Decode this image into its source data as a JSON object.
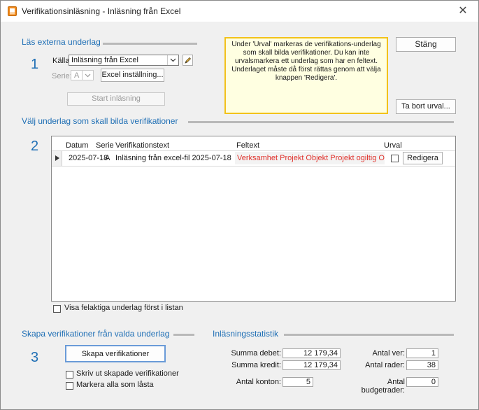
{
  "window": {
    "title": "Verifikationsinläsning - Inläsning från Excel"
  },
  "section1": {
    "heading": "Läs externa underlag",
    "number": "1",
    "source_label": "Källa:",
    "source_value": "Inläsning från Excel",
    "serie_label": "Serie:",
    "serie_value": "A",
    "excel_settings_button": "Excel inställning...",
    "start_button": "Start inläsning"
  },
  "info_text": "Under 'Urval' markeras de verifikations-underlag som skall bilda verifikationer. Du kan inte urvalsmarkera ett underlag som har en feltext. Underlaget måste då först rättas genom att välja knappen 'Redigera'.",
  "buttons": {
    "close": "Stäng",
    "remove_selection": "Ta bort urval..."
  },
  "section2": {
    "heading": "Välj underlag som skall bilda verifikationer",
    "number": "2",
    "columns": {
      "date": "Datum",
      "serie": "Serie",
      "text": "Verifikationstext",
      "error": "Feltext",
      "select": "Urval"
    },
    "rows": [
      {
        "date": "2025-07-18",
        "serie": "A",
        "text": "Inläsning från excel-fil 2025-07-18",
        "error": "Verksamhet Projekt Objekt Projekt ogiltig Objekt o",
        "edit": "Redigera"
      }
    ],
    "show_invalid_first": "Visa felaktiga underlag först i listan"
  },
  "section3": {
    "heading": "Skapa verifikationer från valda underlag",
    "number": "3",
    "create_button": "Skapa verifikationer",
    "print_checkbox": "Skriv ut skapade verifikationer",
    "mark_locked_checkbox": "Markera alla som låsta"
  },
  "stats": {
    "heading": "Inläsningsstatistik",
    "sum_debit_label": "Summa debet:",
    "sum_debit": "12 179,34",
    "sum_credit_label": "Summa kredit:",
    "sum_credit": "12 179,34",
    "accounts_label": "Antal konton:",
    "accounts": "5",
    "vouchers_label": "Antal ver:",
    "vouchers": "1",
    "rows_label": "Antal rader:",
    "rows": "38",
    "budget_rows_label": "Antal budgetrader:",
    "budget_rows": "0"
  },
  "colors": {
    "accent": "#1f6fb5",
    "error_text": "#e0322c",
    "info_border": "#f2c21a",
    "info_bg": "#ffffe1"
  }
}
